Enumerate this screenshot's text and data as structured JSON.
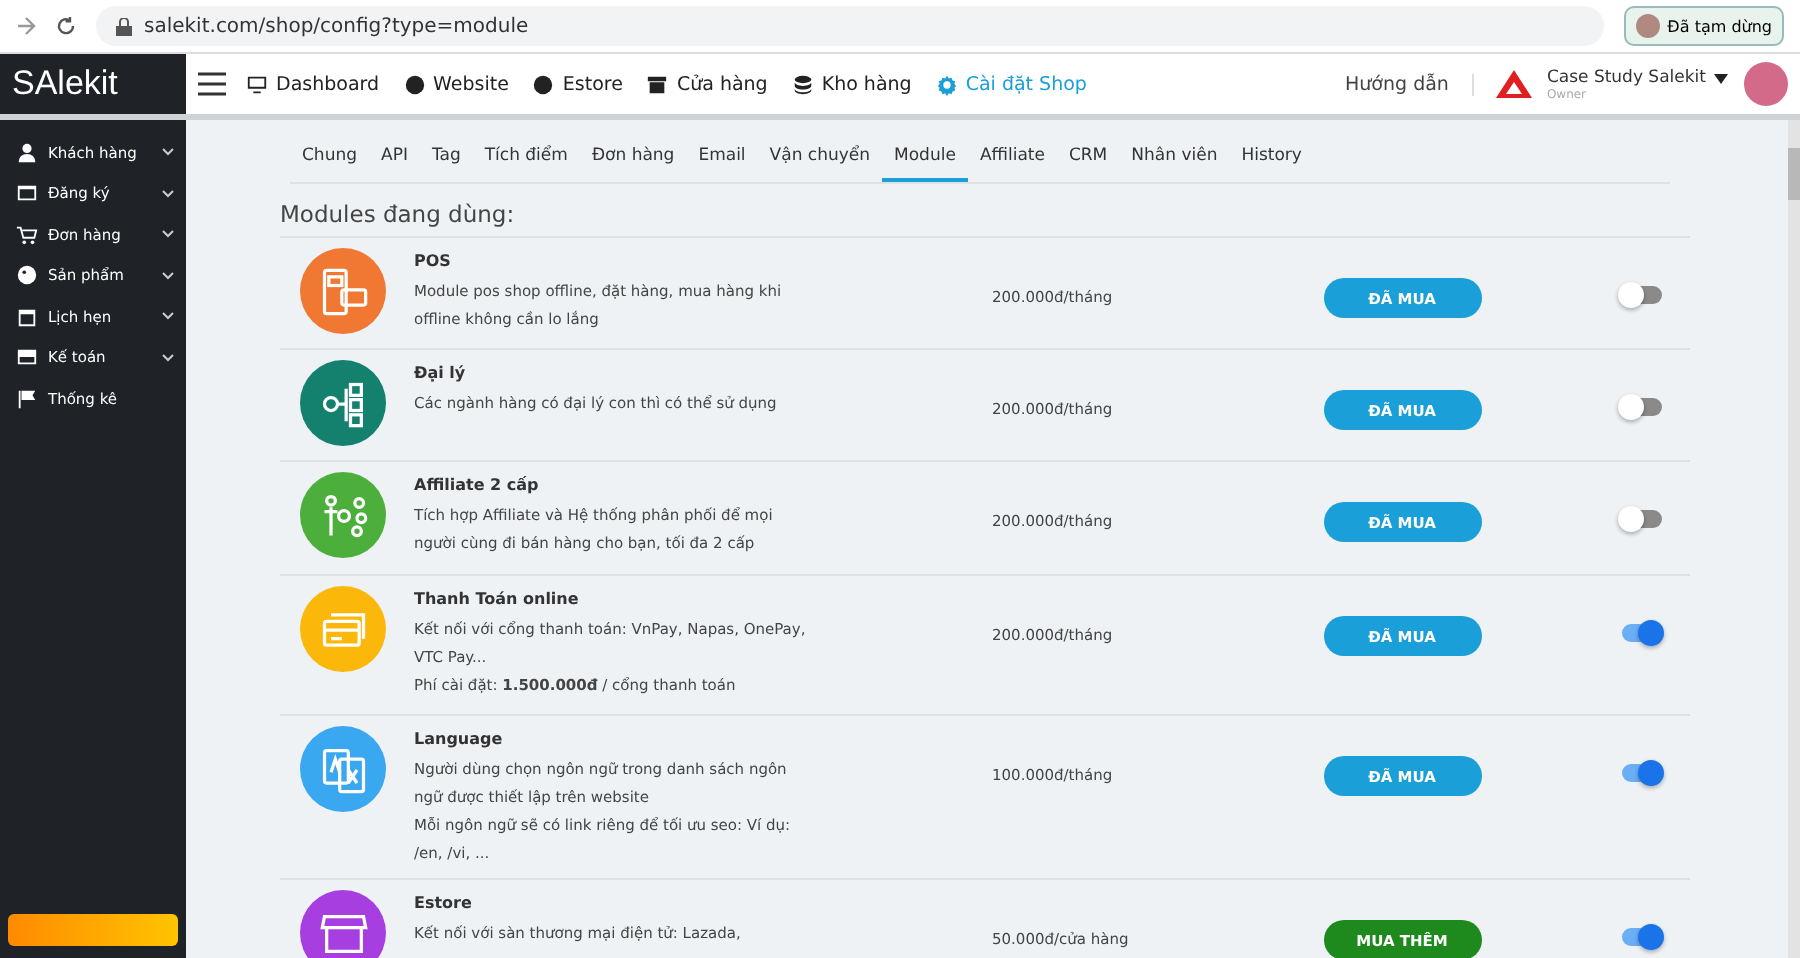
{
  "browser": {
    "url": "salekit.com/shop/config?type=module",
    "profile_label": "Đã tạm dừng"
  },
  "header": {
    "logo": "SAlekit",
    "nav": [
      {
        "label": "Dashboard",
        "selected": false
      },
      {
        "label": "Website",
        "selected": false
      },
      {
        "label": "Estore",
        "selected": false
      },
      {
        "label": "Cửa hàng",
        "selected": false
      },
      {
        "label": "Kho hàng",
        "selected": false
      },
      {
        "label": "Cài đặt Shop",
        "selected": true
      }
    ],
    "help": "Hướng dẫn",
    "account": {
      "name": "Case Study Salekit",
      "role": "Owner"
    }
  },
  "sidebar": {
    "items": [
      {
        "label": "Khách hàng",
        "expandable": true
      },
      {
        "label": "Đăng ký",
        "expandable": true
      },
      {
        "label": "Đơn hàng",
        "expandable": true
      },
      {
        "label": "Sản phẩm",
        "expandable": true
      },
      {
        "label": "Lịch hẹn",
        "expandable": true
      },
      {
        "label": "Kế toán",
        "expandable": true
      },
      {
        "label": "Thống kê",
        "expandable": false
      }
    ]
  },
  "tabs": [
    {
      "label": "Chung",
      "selected": false
    },
    {
      "label": "API",
      "selected": false
    },
    {
      "label": "Tag",
      "selected": false
    },
    {
      "label": "Tích điểm",
      "selected": false
    },
    {
      "label": "Đơn hàng",
      "selected": false
    },
    {
      "label": "Email",
      "selected": false
    },
    {
      "label": "Vận chuyển",
      "selected": false
    },
    {
      "label": "Module",
      "selected": true
    },
    {
      "label": "Affiliate",
      "selected": false
    },
    {
      "label": "CRM",
      "selected": false
    },
    {
      "label": "Nhân viên",
      "selected": false
    },
    {
      "label": "History",
      "selected": false
    }
  ],
  "section_title": "Modules đang dùng:",
  "modules": [
    {
      "name": "POS",
      "color": "#f07832",
      "description": [
        "Module pos shop offline, đặt hàng, mua hàng khi offline không cần lo lắng"
      ],
      "price": "200.000đ/tháng",
      "button": {
        "label": "ĐÃ MUA",
        "kind": "purchased"
      },
      "on": false
    },
    {
      "name": "Đại lý",
      "color": "#14806e",
      "description": [
        "Các ngành hàng có đại lý con thì có thể sử dụng"
      ],
      "price": "200.000đ/tháng",
      "button": {
        "label": "ĐÃ MUA",
        "kind": "purchased"
      },
      "on": false
    },
    {
      "name": "Affiliate 2 cấp",
      "color": "#4caf3c",
      "description": [
        "Tích hợp Affiliate và Hệ thống phân phối để mọi người cùng đi bán hàng cho bạn, tối đa 2 cấp"
      ],
      "price": "200.000đ/tháng",
      "button": {
        "label": "ĐÃ MUA",
        "kind": "purchased"
      },
      "on": false
    },
    {
      "name": "Thanh Toán online",
      "color": "#fbb80a",
      "description": [
        "Kết nối với cổng thanh toán: VnPay, Napas, OnePay, VTC Pay...",
        "Phí cài đặt: **1.500.000đ** / cổng thanh toán"
      ],
      "price": "200.000đ/tháng",
      "button": {
        "label": "ĐÃ MUA",
        "kind": "purchased"
      },
      "on": true
    },
    {
      "name": "Language",
      "color": "#3aa8f0",
      "description": [
        "Người dùng chọn ngôn ngữ trong danh sách ngôn ngữ được thiết lập trên website",
        "Mỗi ngôn ngữ sẽ có link riêng để tối ưu seo: Ví dụ: /en, /vi, ..."
      ],
      "price": "100.000đ/tháng",
      "button": {
        "label": "ĐÃ MUA",
        "kind": "purchased"
      },
      "on": true
    },
    {
      "name": "Estore",
      "color": "#a73ee0",
      "description": [
        "Kết nối với sàn thương mại điện tử: Lazada,"
      ],
      "price": "50.000đ/cửa hàng",
      "button": {
        "label": "MUA THÊM",
        "kind": "buy_more"
      },
      "on": true
    }
  ]
}
